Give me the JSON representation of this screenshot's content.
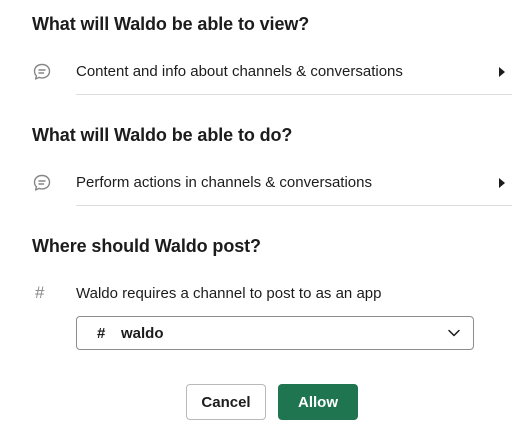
{
  "app_name": "Waldo",
  "view_section": {
    "heading": "What will Waldo be able to view?",
    "items": [
      {
        "label": "Content and info about channels & conversations",
        "icon": "message-bubble-icon"
      }
    ]
  },
  "do_section": {
    "heading": "What will Waldo be able to do?",
    "items": [
      {
        "label": "Perform actions in channels & conversations",
        "icon": "message-bubble-icon"
      }
    ]
  },
  "post_section": {
    "heading": "Where should Waldo post?",
    "description": "Waldo requires a channel to post to as an app",
    "hash_symbol": "#",
    "channel_select": {
      "prefix": "#",
      "selected": "waldo"
    }
  },
  "actions": {
    "cancel_label": "Cancel",
    "allow_label": "Allow"
  },
  "colors": {
    "primary_button": "#1e7550",
    "text": "#1d1c1d",
    "icon_muted": "#868686",
    "divider": "#dddddd"
  }
}
